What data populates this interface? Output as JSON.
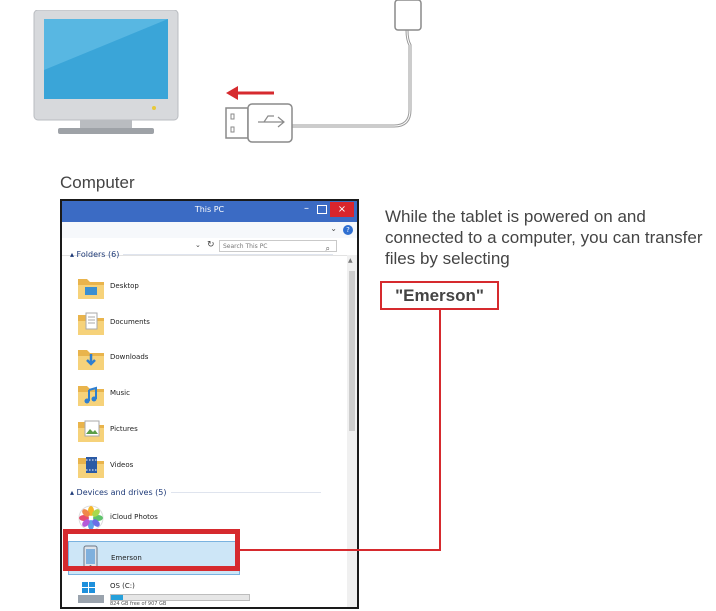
{
  "illustration": {
    "computer_caption": "Computer"
  },
  "explorer": {
    "title": "This PC",
    "window_controls": {
      "minimize": "–",
      "close": "×"
    },
    "ribbon": {
      "collapse": "⌄",
      "help": "?"
    },
    "address": {
      "dropdown": "⌄",
      "refresh": "↻",
      "search_placeholder": "Search This PC",
      "search_icon": "⌕"
    },
    "folders_header": "▴ Folders (6)",
    "folders": [
      {
        "label": "Desktop",
        "icon": "desktop-folder-icon"
      },
      {
        "label": "Documents",
        "icon": "documents-folder-icon"
      },
      {
        "label": "Downloads",
        "icon": "downloads-folder-icon"
      },
      {
        "label": "Music",
        "icon": "music-folder-icon"
      },
      {
        "label": "Pictures",
        "icon": "pictures-folder-icon"
      },
      {
        "label": "Videos",
        "icon": "videos-folder-icon"
      }
    ],
    "devices_header": "▴ Devices and drives (5)",
    "devices": [
      {
        "label": "iCloud Photos",
        "icon": "icloud-photos-icon"
      },
      {
        "label": "Emerson",
        "icon": "tablet-device-icon",
        "selected": true
      },
      {
        "label": "OS (C:)",
        "icon": "windows-drive-icon",
        "free_text": "824 GB free of 907 GB",
        "used_fraction": 0.09
      }
    ]
  },
  "instruction": {
    "text": "While the tablet is powered on and connected to a computer, you can transfer files by selecting",
    "highlight": "\"Emerson\""
  },
  "colors": {
    "accent_red": "#d62a2e",
    "title_blue": "#3b6bc4",
    "folder_yellow": "#f2c45a"
  }
}
